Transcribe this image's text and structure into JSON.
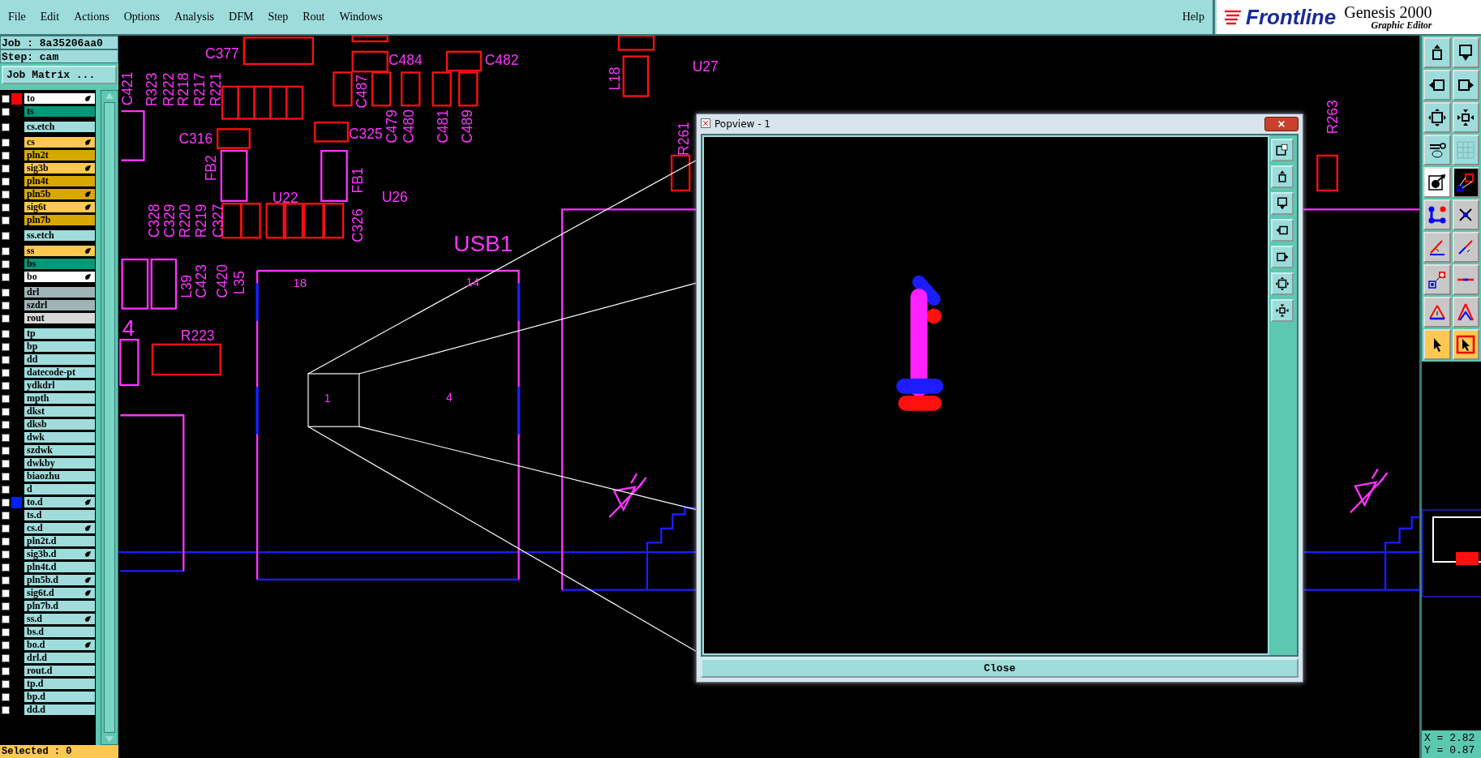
{
  "menu": {
    "items": [
      "File",
      "Edit",
      "Actions",
      "Options",
      "Analysis",
      "DFM",
      "Step",
      "Rout",
      "Windows"
    ],
    "help": "Help"
  },
  "brand": {
    "logo": "Frontline",
    "product": "Genesis 2000",
    "subtitle": "Graphic Editor"
  },
  "job": {
    "job": "Job : 8a35206aa0",
    "step": "Step: cam",
    "matrix_button": "Job Matrix ..."
  },
  "layer_groups": [
    {
      "layers": [
        {
          "name": "to",
          "kind": "silk",
          "color": "#ff0000",
          "checked": false,
          "affected": true
        },
        {
          "name": "ts",
          "kind": "mask",
          "checked": false,
          "affected": false
        }
      ]
    },
    {
      "layers": [
        {
          "name": "cs.etch",
          "kind": "document",
          "checked": false,
          "affected": false
        }
      ]
    },
    {
      "layers": [
        {
          "name": "cs",
          "kind": "signal",
          "checked": false,
          "affected": true
        },
        {
          "name": "pln2t",
          "kind": "plane",
          "checked": false,
          "affected": false
        },
        {
          "name": "sig3b",
          "kind": "signal",
          "checked": false,
          "affected": true
        },
        {
          "name": "pln4t",
          "kind": "plane",
          "checked": false,
          "affected": false
        },
        {
          "name": "pln5b",
          "kind": "plane",
          "checked": false,
          "affected": true
        },
        {
          "name": "sig6t",
          "kind": "signal",
          "checked": false,
          "affected": true
        },
        {
          "name": "pln7b",
          "kind": "plane",
          "checked": false,
          "affected": false
        }
      ]
    },
    {
      "layers": [
        {
          "name": "ss.etch",
          "kind": "document",
          "checked": false,
          "affected": false
        }
      ]
    },
    {
      "layers": [
        {
          "name": "ss",
          "kind": "signal",
          "checked": false,
          "affected": true
        },
        {
          "name": "bs",
          "kind": "mask",
          "checked": false,
          "affected": false
        },
        {
          "name": "bo",
          "kind": "silk",
          "checked": false,
          "affected": true
        }
      ]
    },
    {
      "layers": [
        {
          "name": "drl",
          "kind": "drill",
          "checked": false,
          "affected": false
        },
        {
          "name": "szdrl",
          "kind": "drill",
          "checked": false,
          "affected": false
        },
        {
          "name": "rout",
          "kind": "rout",
          "checked": false,
          "affected": false
        }
      ]
    },
    {
      "layers": [
        {
          "name": "tp",
          "kind": "document",
          "checked": false,
          "affected": false
        },
        {
          "name": "bp",
          "kind": "document",
          "checked": false,
          "affected": false
        },
        {
          "name": "dd",
          "kind": "document",
          "checked": false,
          "affected": false
        },
        {
          "name": "datecode-pt",
          "kind": "document",
          "checked": false,
          "affected": false
        },
        {
          "name": "ydkdrl",
          "kind": "document",
          "checked": false,
          "affected": false
        },
        {
          "name": "mpth",
          "kind": "document",
          "checked": false,
          "affected": false
        },
        {
          "name": "dkst",
          "kind": "document",
          "checked": false,
          "affected": false
        },
        {
          "name": "dksb",
          "kind": "document",
          "checked": false,
          "affected": false
        },
        {
          "name": "dwk",
          "kind": "document",
          "checked": false,
          "affected": false
        },
        {
          "name": "szdwk",
          "kind": "document",
          "checked": false,
          "affected": false
        },
        {
          "name": "dwkby",
          "kind": "document",
          "checked": false,
          "affected": false
        },
        {
          "name": "biaozhu",
          "kind": "document",
          "checked": false,
          "affected": false
        },
        {
          "name": "d",
          "kind": "document",
          "checked": false,
          "affected": false
        },
        {
          "name": "to.d",
          "kind": "document",
          "color": "#0020ff",
          "checked": false,
          "affected": true
        },
        {
          "name": "ts.d",
          "kind": "document",
          "checked": false,
          "affected": false
        },
        {
          "name": "cs.d",
          "kind": "document",
          "checked": false,
          "affected": true
        },
        {
          "name": "pln2t.d",
          "kind": "document",
          "checked": false,
          "affected": false
        },
        {
          "name": "sig3b.d",
          "kind": "document",
          "checked": false,
          "affected": true
        },
        {
          "name": "pln4t.d",
          "kind": "document",
          "checked": false,
          "affected": false
        },
        {
          "name": "pln5b.d",
          "kind": "document",
          "checked": false,
          "affected": true
        },
        {
          "name": "sig6t.d",
          "kind": "document",
          "checked": false,
          "affected": true
        },
        {
          "name": "pln7b.d",
          "kind": "document",
          "checked": false,
          "affected": false
        },
        {
          "name": "ss.d",
          "kind": "document",
          "checked": false,
          "affected": true
        },
        {
          "name": "bs.d",
          "kind": "document",
          "checked": false,
          "affected": false
        },
        {
          "name": "bo.d",
          "kind": "document",
          "checked": false,
          "affected": true
        },
        {
          "name": "drl.d",
          "kind": "document",
          "checked": false,
          "affected": false
        },
        {
          "name": "rout.d",
          "kind": "document",
          "checked": false,
          "affected": false
        },
        {
          "name": "tp.d",
          "kind": "document",
          "checked": false,
          "affected": false
        },
        {
          "name": "bp.d",
          "kind": "document",
          "checked": false,
          "affected": false
        },
        {
          "name": "dd.d",
          "kind": "document",
          "checked": false,
          "affected": false
        }
      ]
    }
  ],
  "selected_status": "Selected : 0",
  "canvas": {
    "labels": [
      "C377",
      "C484",
      "C482",
      "L18",
      "U27",
      "C421",
      "R323",
      "R222",
      "R218",
      "R217",
      "R221",
      "C487",
      "C479",
      "C480",
      "C481",
      "C489",
      "C316",
      "C325",
      "FB2",
      "FB1",
      "U22",
      "U26",
      "C328",
      "C329",
      "R220",
      "R219",
      "C327",
      "C326",
      "USB1",
      "18",
      "14",
      "L39",
      "C423",
      "C420",
      "L35",
      "4",
      "R223",
      "1",
      "4",
      "R261",
      "R263"
    ]
  },
  "popup": {
    "title": "Popview - 1",
    "close_button": "Close"
  },
  "coordinates": {
    "x": "X = 2.82",
    "y": "Y = 0.87"
  }
}
